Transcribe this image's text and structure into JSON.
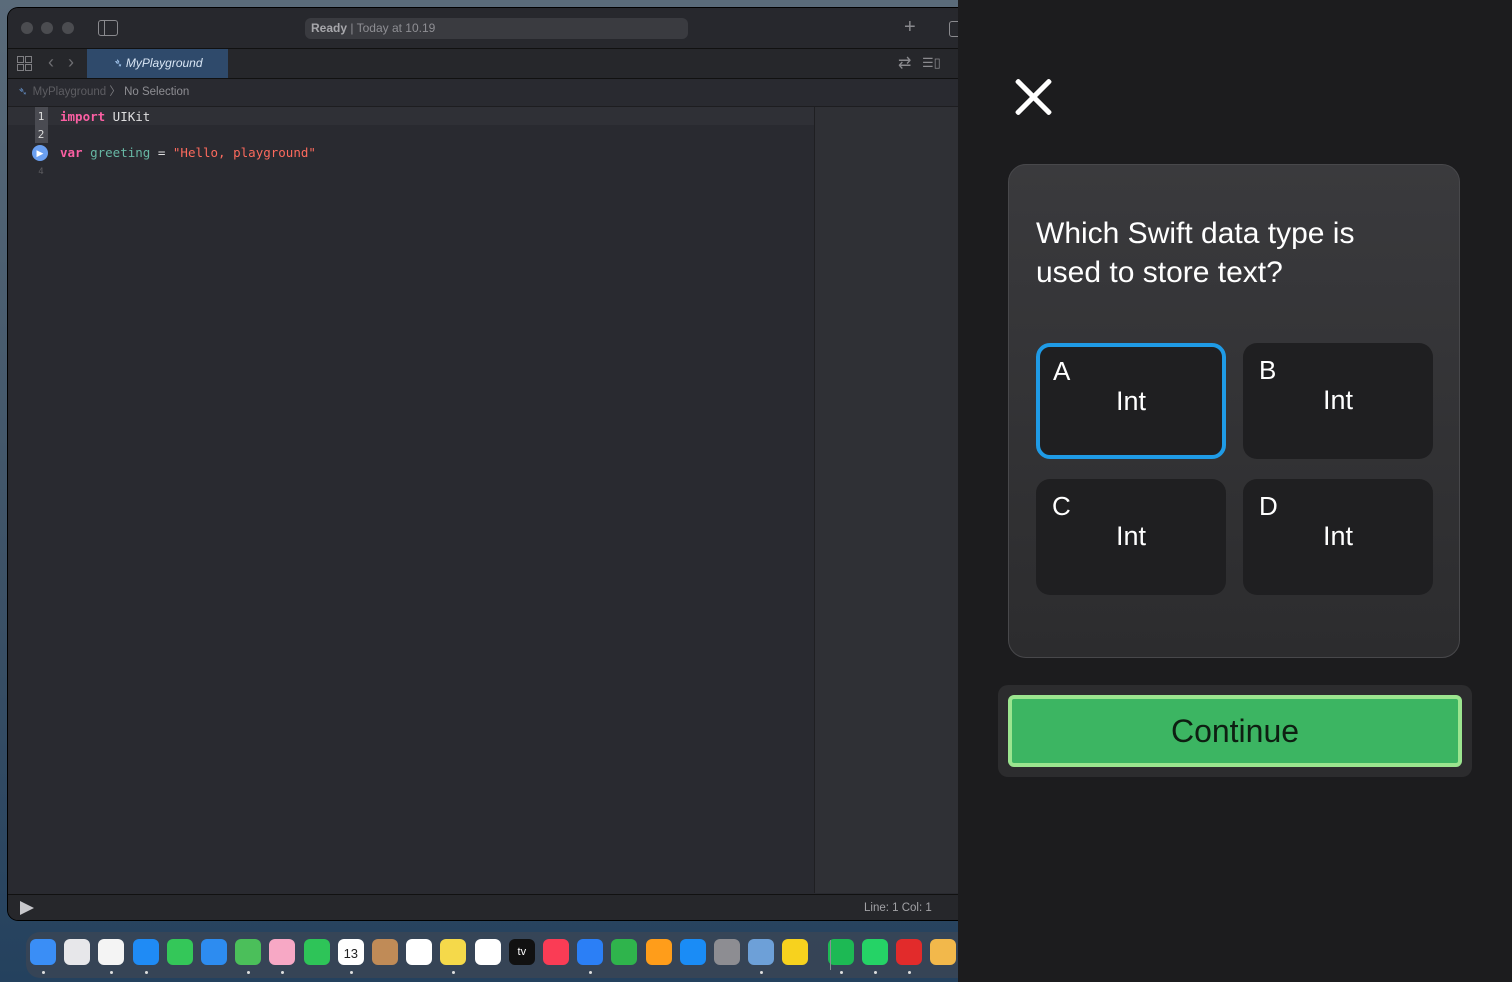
{
  "xcode": {
    "status_ready": "Ready",
    "status_time": "| Today at 10.19",
    "tab_label": "MyPlayground",
    "breadcrumb_project": "MyPlayground",
    "breadcrumb_sep": "〉",
    "breadcrumb_selection": "No Selection",
    "gutter": [
      "1",
      "2",
      "4"
    ],
    "code": {
      "line1_kw": "import",
      "line1_rest": " UIKit",
      "line3_kw": "var",
      "line3_name": "greeting",
      "line3_eq": " = ",
      "line3_str": "\"Hello, playground\""
    },
    "line_col": "Line: 1  Col: 1"
  },
  "dock": {
    "icons": [
      "finder-icon",
      "launchpad-icon",
      "chrome-icon",
      "safari-icon",
      "messages-icon",
      "mail-icon",
      "maps-icon",
      "photos-icon",
      "facetime-icon",
      "calendar-icon",
      "contacts-icon",
      "reminders-icon",
      "notes-icon",
      "freeform-icon",
      "appletv-icon",
      "music-icon",
      "keynote-icon",
      "numbers-icon",
      "pages-icon",
      "appstore-icon",
      "settings-icon",
      "xcode-icon",
      "miro-icon",
      "spotify-icon",
      "whatsapp-icon",
      "acrobat-icon",
      "app-icon"
    ],
    "colors": [
      "#3a8ef6",
      "#e7e7ea",
      "#f4f4f4",
      "#1f8bf5",
      "#34c759",
      "#2d8cf0",
      "#4bbf5a",
      "#f7a8c5",
      "#2ec458",
      "#ffffff",
      "#c08b57",
      "#ffffff",
      "#f5d94a",
      "#ffffff",
      "#111111",
      "#fa3c55",
      "#2b7ff6",
      "#2fb44c",
      "#ff9d1a",
      "#1a8cf6",
      "#8d8d92",
      "#6da0d8",
      "#f7d21e",
      "#1db954",
      "#25d366",
      "#e22b2b",
      "#f2b84b"
    ],
    "calendar_month": "AUG",
    "calendar_day": "13",
    "appletv_label": "tv"
  },
  "quiz": {
    "question": "Which Swift data type is used to store text?",
    "options": [
      {
        "letter": "A",
        "text": "Int"
      },
      {
        "letter": "B",
        "text": "Int"
      },
      {
        "letter": "C",
        "text": "Int"
      },
      {
        "letter": "D",
        "text": "Int"
      }
    ],
    "selected_option": "A",
    "continue_label": "Continue",
    "colors": {
      "selected_border": "#1f9be6",
      "continue_fill": "#3cb562",
      "continue_border": "#9be58f"
    }
  }
}
